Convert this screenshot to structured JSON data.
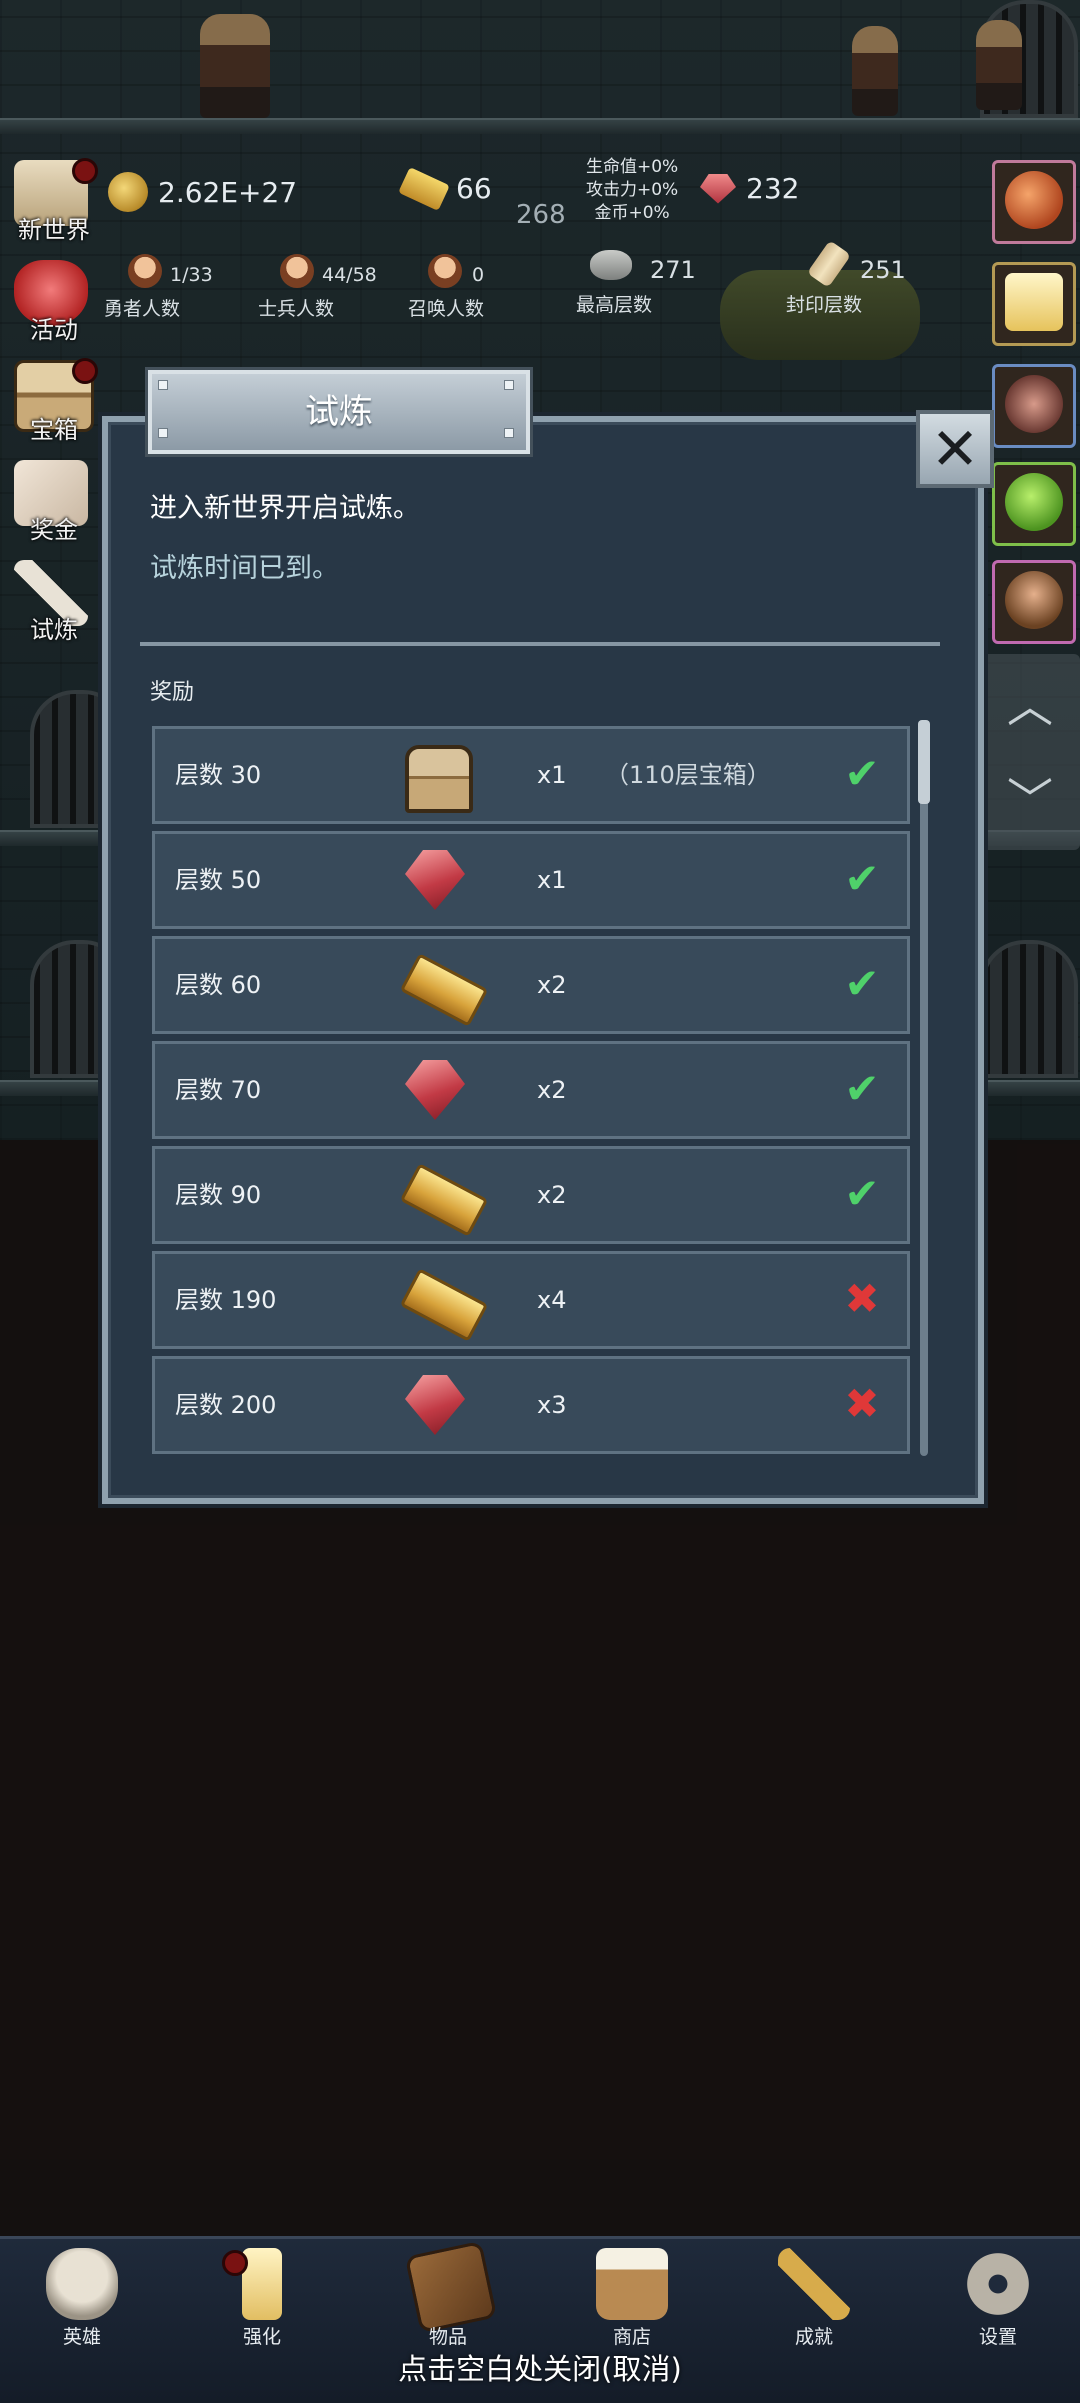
{
  "top_stats": {
    "coins": "2.62E+27",
    "gold": "66",
    "rubies": "232",
    "center_value": "268",
    "bonuses": [
      "生命值+0%",
      "攻击力+0%",
      "金币+0%"
    ],
    "heroes": {
      "value": "1/33",
      "label": "勇者人数"
    },
    "soldiers": {
      "value": "44/58",
      "label": "士兵人数"
    },
    "summons": {
      "value": "0",
      "label": "召唤人数"
    },
    "max_floor": {
      "value": "271",
      "label": "最高层数"
    },
    "sealed_floor": {
      "value": "251",
      "label": "封印层数"
    }
  },
  "side_menu": [
    {
      "label": "新世界",
      "badge": true
    },
    {
      "label": "活动",
      "badge": false
    },
    {
      "label": "宝箱",
      "badge": true
    },
    {
      "label": "奖金",
      "badge": false
    },
    {
      "label": "试炼",
      "badge": false
    }
  ],
  "dialog": {
    "title": "试炼",
    "message": "进入新世界开启试炼。",
    "status": "试炼时间已到。",
    "rewards_label": "奖励",
    "close_icon": "close-icon"
  },
  "rewards": [
    {
      "floor": "层数 30",
      "item": "chest",
      "qty": "x1",
      "note": "（110层宝箱）",
      "claimed": true
    },
    {
      "floor": "层数 50",
      "item": "ruby",
      "qty": "x1",
      "note": "",
      "claimed": true
    },
    {
      "floor": "层数 60",
      "item": "gold",
      "qty": "x2",
      "note": "",
      "claimed": true
    },
    {
      "floor": "层数 70",
      "item": "ruby",
      "qty": "x2",
      "note": "",
      "claimed": true
    },
    {
      "floor": "层数 90",
      "item": "gold",
      "qty": "x2",
      "note": "",
      "claimed": true
    },
    {
      "floor": "层数 190",
      "item": "gold",
      "qty": "x4",
      "note": "",
      "claimed": false
    },
    {
      "floor": "层数 200",
      "item": "ruby",
      "qty": "x3",
      "note": "",
      "claimed": false
    }
  ],
  "status_glyphs": {
    "claimed": "✔",
    "unclaimed": "✖"
  },
  "bottom_nav": [
    {
      "label": "英雄",
      "icon": "skull-icon"
    },
    {
      "label": "强化",
      "icon": "candle-icon",
      "badge": true
    },
    {
      "label": "物品",
      "icon": "book-icon"
    },
    {
      "label": "商店",
      "icon": "mug-icon"
    },
    {
      "label": "成就",
      "icon": "key-icon"
    },
    {
      "label": "设置",
      "icon": "gear-icon"
    }
  ],
  "close_hint": "点击空白处关闭(取消)",
  "colors": {
    "claimed": "#4fd16a",
    "unclaimed": "#e03838",
    "dialog_bg": "#283746",
    "status_text": "#b7d3dc"
  }
}
